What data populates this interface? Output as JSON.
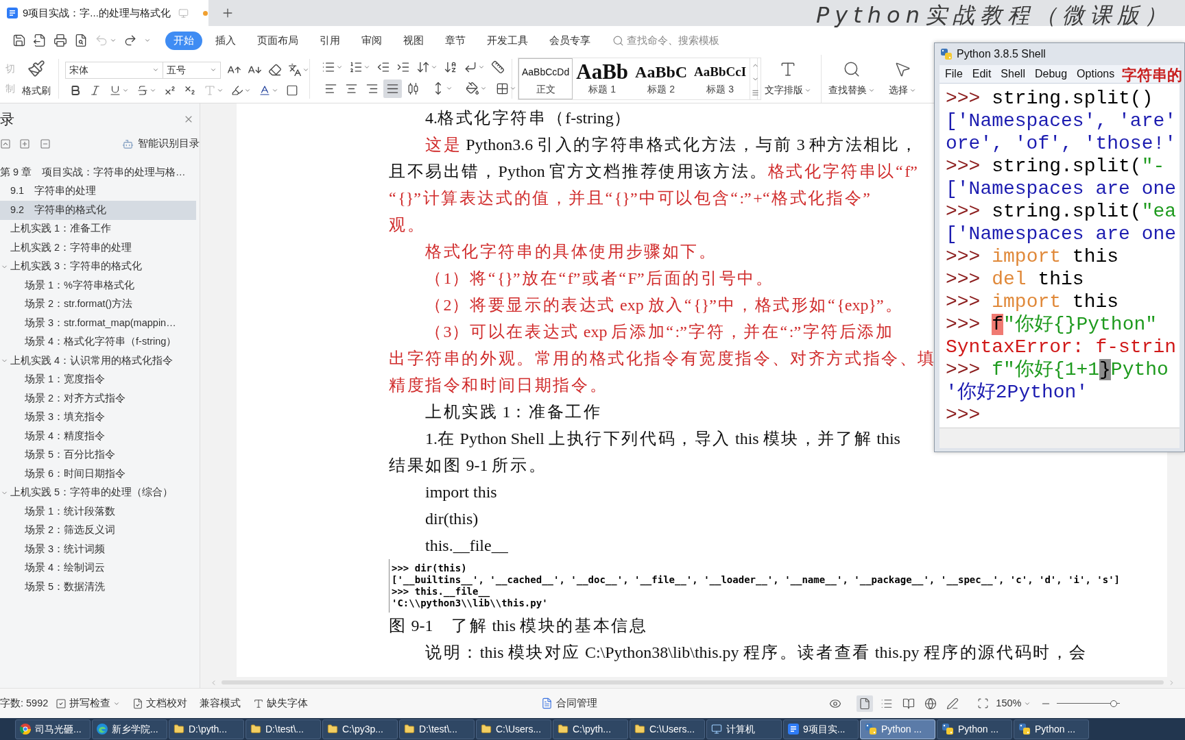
{
  "overlay_title": "Python实战教程（微课版）",
  "tabs": [
    {
      "title": "9项目实战：字...的处理与格式化",
      "selected": true,
      "unsaved": true
    }
  ],
  "quick_access": {
    "undo": {
      "disabled": true
    }
  },
  "menu_tabs": [
    {
      "label": "开始",
      "selected": true
    },
    {
      "label": "插入",
      "selected": false
    },
    {
      "label": "页面布局",
      "selected": false
    },
    {
      "label": "引用",
      "selected": false
    },
    {
      "label": "审阅",
      "selected": false
    },
    {
      "label": "视图",
      "selected": false
    },
    {
      "label": "章节",
      "selected": false
    },
    {
      "label": "开发工具",
      "selected": false
    },
    {
      "label": "会员专享",
      "selected": false
    }
  ],
  "search": {
    "placeholder": "查找命令、搜索模板"
  },
  "ribbon": {
    "clipboard": {
      "cut": {
        "label": "切",
        "disabled": true
      },
      "copy": {
        "label": "制",
        "disabled": true
      },
      "format_painter": "格式刷"
    },
    "font": {
      "family": "宋体",
      "size": "五号"
    },
    "alignment": [
      {
        "kind": "left",
        "selected": false
      },
      {
        "kind": "center",
        "selected": false
      },
      {
        "kind": "right",
        "selected": false
      },
      {
        "kind": "justify",
        "selected": true
      },
      {
        "kind": "distributed",
        "selected": false
      }
    ],
    "styles": [
      {
        "kind": "body",
        "sample": "AaBbCcDd",
        "label": "正文",
        "selected": true
      },
      {
        "kind": "heading1",
        "sample": "AaBb",
        "label": "标题 1",
        "selected": false
      },
      {
        "kind": "heading2",
        "sample": "AaBbC",
        "label": "标题 2",
        "selected": false
      },
      {
        "kind": "heading3",
        "sample": "AaBbCcI",
        "label": "标题 3",
        "selected": false
      }
    ],
    "tools": [
      {
        "kind": "layout",
        "label": "文字排版"
      },
      {
        "kind": "find",
        "label": "查找替换"
      },
      {
        "kind": "select",
        "label": "选择"
      }
    ]
  },
  "sidebar": {
    "title": "录",
    "smart_toc": "智能识别目录",
    "toc": [
      {
        "label": "第 9 章　项目实战：字符串的处理与格…",
        "selected": false,
        "children": [
          {
            "label": "9.1　字符串的处理",
            "selected": false
          },
          {
            "label": "9.2　字符串的格式化",
            "selected": true
          },
          {
            "label": "上机实践 1：准备工作",
            "selected": false
          },
          {
            "label": "上机实践 2：字符串的处理",
            "selected": false
          },
          {
            "label": "上机实践 3：字符串的格式化",
            "selected": false,
            "expanded": true,
            "children": [
              {
                "label": "场景 1：%字符串格式化",
                "selected": false
              },
              {
                "label": "场景 2：str.format()方法",
                "selected": false
              },
              {
                "label": "场景 3：str.format_map(mappin…",
                "selected": false
              },
              {
                "label": "场景 4：格式化字符串（f-string）",
                "selected": false
              }
            ]
          },
          {
            "label": "上机实践 4：认识常用的格式化指令",
            "selected": false,
            "expanded": true,
            "children": [
              {
                "label": "场景 1：宽度指令",
                "selected": false
              },
              {
                "label": "场景 2：对齐方式指令",
                "selected": false
              },
              {
                "label": "场景 3：填充指令",
                "selected": false
              },
              {
                "label": "场景 4：精度指令",
                "selected": false
              },
              {
                "label": "场景 5：百分比指令",
                "selected": false
              },
              {
                "label": "场景 6：时间日期指令",
                "selected": false
              }
            ]
          },
          {
            "label": "上机实践 5：字符串的处理（综合）",
            "selected": false,
            "expanded": true,
            "children": [
              {
                "label": "场景 1：统计段落数",
                "selected": false
              },
              {
                "label": "场景 2：筛选反义词",
                "selected": false
              },
              {
                "label": "场景 3：统计词频",
                "selected": false
              },
              {
                "label": "场景 4：绘制词云",
                "selected": false
              },
              {
                "label": "场景 5：数据清洗",
                "selected": false
              }
            ]
          }
        ]
      }
    ]
  },
  "document": {
    "blocks": [
      {
        "kind": "paragraph",
        "lines": [
          [
            {
              "text": "4.格式化字符串（f-string）",
              "emphasis": false
            }
          ]
        ]
      },
      {
        "kind": "paragraph",
        "lines": [
          [
            {
              "text": "这是",
              "emphasis": true
            },
            {
              "text": " Python3.6 引入的字符串格式化方法，与前 3 种方法相比，",
              "emphasis": false
            }
          ],
          [
            {
              "text": "且不易出错，Python 官方文档推荐使用该方法。",
              "emphasis": false
            },
            {
              "text": "格式化字符串以“f”",
              "emphasis": true
            }
          ],
          [
            {
              "text": "“{}”计算表达式的值，并且“{}”中可以包含“:”+“格式化指令”",
              "emphasis": true
            }
          ],
          [
            {
              "text": "观。",
              "emphasis": true
            }
          ]
        ]
      },
      {
        "kind": "paragraph",
        "lines": [
          [
            {
              "text": "格式化字符串的具体使用步骤如下。",
              "emphasis": true
            }
          ]
        ]
      },
      {
        "kind": "paragraph",
        "lines": [
          [
            {
              "text": "（1）将“{}”放在“f”或者“F”后面的引号中。",
              "emphasis": true
            }
          ]
        ]
      },
      {
        "kind": "paragraph",
        "lines": [
          [
            {
              "text": "（2）将要显示的表达式 exp 放入“{}”中，格式形如“{exp}”。",
              "emphasis": true
            }
          ]
        ]
      },
      {
        "kind": "paragraph",
        "lines": [
          [
            {
              "text": "（3）可以在表达式 exp 后添加“:”字符，并在“:”字符后添加",
              "emphasis": true
            }
          ],
          [
            {
              "text": "出字符串的外观。常用的格式化指令有宽度指令、对齐方式指令、填",
              "emphasis": true
            }
          ],
          [
            {
              "text": "精度指令和时间日期指令。",
              "emphasis": true
            }
          ]
        ]
      },
      {
        "kind": "paragraph",
        "lines": [
          [
            {
              "text": "上机实践 1：准备工作",
              "emphasis": false
            }
          ]
        ]
      },
      {
        "kind": "paragraph",
        "lines": [
          [
            {
              "text": "1.在 Python Shell 上执行下列代码，导入 this 模块，并了解 this",
              "emphasis": false
            }
          ],
          [
            {
              "text": "结果如图 9-1 所示。",
              "emphasis": false
            }
          ]
        ]
      },
      {
        "kind": "paragraph",
        "lines": [
          [
            {
              "text": "import this",
              "emphasis": false
            }
          ]
        ]
      },
      {
        "kind": "paragraph",
        "lines": [
          [
            {
              "text": "dir(this)",
              "emphasis": false
            }
          ]
        ]
      },
      {
        "kind": "paragraph",
        "lines": [
          [
            {
              "text": "this.__file__",
              "emphasis": false
            }
          ]
        ]
      },
      {
        "kind": "code_shot",
        "lines": [
          ">>> dir(this)",
          "['__builtins__', '__cached__', '__doc__', '__file__', '__loader__', '__name__', '__package__', '__spec__', 'c', 'd', 'i', 's']",
          ">>> this.__file__",
          "'C:\\\\python3\\\\lib\\\\this.py'"
        ]
      },
      {
        "kind": "caption",
        "text": "图 9-1　了解 this 模块的基本信息"
      },
      {
        "kind": "paragraph",
        "lines": [
          [
            {
              "text": "说明：this 模块对应 C:\\Python38\\lib\\this.py 程序。读者查看 this.py 程序的源代码时，会",
              "emphasis": false
            }
          ]
        ]
      }
    ]
  },
  "shell": {
    "title": "Python 3.8.5 Shell",
    "menu": [
      "File",
      "Edit",
      "Shell",
      "Debug",
      "Options"
    ],
    "annotation": "字符串的",
    "lines": [
      [
        {
          "kind": "prompt",
          "text": ">>> "
        },
        {
          "kind": "code",
          "text": "string.split()"
        }
      ],
      [
        {
          "kind": "output",
          "text": "['Namespaces', 'are'"
        }
      ],
      [
        {
          "kind": "output",
          "text": "ore', 'of', 'those!'"
        }
      ],
      [
        {
          "kind": "prompt",
          "text": ">>> "
        },
        {
          "kind": "code",
          "text": "string.split("
        },
        {
          "kind": "string",
          "text": "\"-"
        }
      ],
      [
        {
          "kind": "output",
          "text": "['Namespaces are one"
        }
      ],
      [
        {
          "kind": "prompt",
          "text": ">>> "
        },
        {
          "kind": "code",
          "text": "string.split("
        },
        {
          "kind": "string",
          "text": "\"ea"
        }
      ],
      [
        {
          "kind": "output",
          "text": "['Namespaces are one"
        }
      ],
      [
        {
          "kind": "prompt",
          "text": ">>> "
        },
        {
          "kind": "keyword",
          "text": "import"
        },
        {
          "kind": "code",
          "text": " this"
        }
      ],
      [
        {
          "kind": "prompt",
          "text": ">>> "
        },
        {
          "kind": "keyword",
          "text": "del"
        },
        {
          "kind": "code",
          "text": " this"
        }
      ],
      [
        {
          "kind": "prompt",
          "text": ">>> "
        },
        {
          "kind": "keyword",
          "text": "import"
        },
        {
          "kind": "code",
          "text": " this"
        }
      ],
      [
        {
          "kind": "prompt",
          "text": ">>> "
        },
        {
          "kind": "error_mark",
          "text": "f"
        },
        {
          "kind": "string",
          "text": "\"你好{}Python\""
        }
      ],
      [
        {
          "kind": "error",
          "text": "SyntaxError: f-strin"
        }
      ],
      [
        {
          "kind": "prompt",
          "text": ">>> "
        },
        {
          "kind": "string",
          "text": "f\"你好{1+1"
        },
        {
          "kind": "match",
          "text": "}"
        },
        {
          "kind": "string",
          "text": "Pytho"
        }
      ],
      [
        {
          "kind": "output",
          "text": "'你好2Python'"
        }
      ],
      [
        {
          "kind": "prompt",
          "text": ">>>"
        }
      ]
    ]
  },
  "status_bar": {
    "word_count": "字数: 5992",
    "spell_check": "拼写检查",
    "proofread": "文档校对",
    "compat_mode": "兼容模式",
    "missing_fonts": "缺失字体",
    "contract": "合同管理",
    "views": [
      {
        "kind": "page",
        "selected": true
      },
      {
        "kind": "outline",
        "selected": false
      },
      {
        "kind": "reading",
        "selected": false
      },
      {
        "kind": "web",
        "selected": false
      },
      {
        "kind": "write",
        "selected": false
      }
    ],
    "zoom": {
      "value": "150%",
      "level": 0.95
    }
  },
  "taskbar": [
    {
      "label": "司马光砸...",
      "kind": "browser",
      "selected": false
    },
    {
      "label": "新乡学院...",
      "kind": "web",
      "selected": false
    },
    {
      "label": "D:\\pyth...",
      "kind": "folder",
      "selected": false
    },
    {
      "label": "D:\\test\\...",
      "kind": "folder",
      "selected": false
    },
    {
      "label": "C:\\py3p...",
      "kind": "folder",
      "selected": false
    },
    {
      "label": "D:\\test\\...",
      "kind": "folder",
      "selected": false
    },
    {
      "label": "C:\\Users...",
      "kind": "folder",
      "selected": false
    },
    {
      "label": "C:\\pyth...",
      "kind": "folder",
      "selected": false
    },
    {
      "label": "C:\\Users...",
      "kind": "folder",
      "selected": false
    },
    {
      "label": "计算机",
      "kind": "computer",
      "selected": false
    },
    {
      "label": "9项目实...",
      "kind": "document",
      "selected": false
    },
    {
      "label": "Python ...",
      "kind": "program",
      "selected": true
    },
    {
      "label": "Python ...",
      "kind": "program",
      "selected": false
    },
    {
      "label": "Python ...",
      "kind": "program",
      "selected": false
    }
  ]
}
